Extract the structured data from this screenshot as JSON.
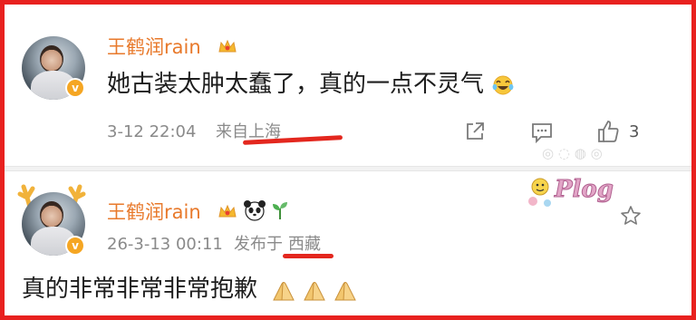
{
  "comments": [
    {
      "user_name": "王鹤润rain",
      "text": "她古装太肿太蠢了，真的一点不灵气",
      "text_emoji": "laughing-face-icon",
      "time": "3-12 22:04",
      "location": "来自上海",
      "like_count": "3"
    },
    {
      "user_name": "王鹤润rain",
      "time": "26-3-13 00:11",
      "location_prefix": "发布于",
      "location": "西藏",
      "text": "真的非常非常非常抱歉",
      "sticker_text": "Plog"
    }
  ],
  "colors": {
    "frame_red": "#e8211f",
    "name_orange": "#e8792b",
    "underline_red": "#e3271e",
    "meta_gray": "#8a8a8a"
  }
}
